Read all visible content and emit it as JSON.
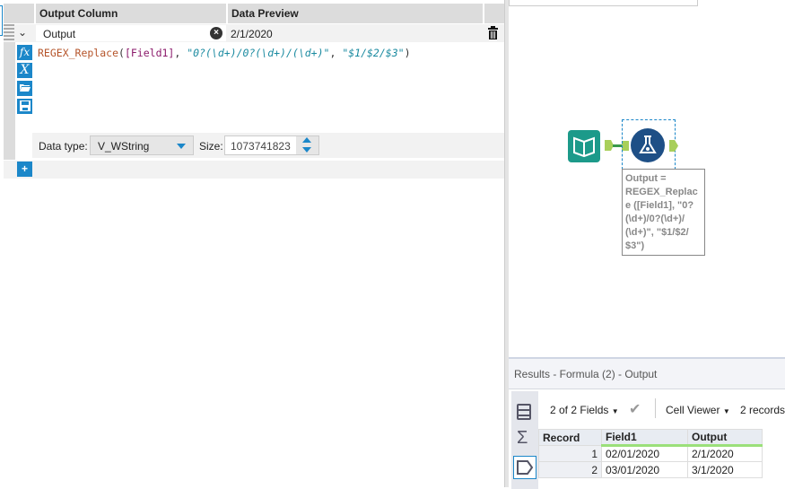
{
  "formula_panel": {
    "headers": {
      "output_column": "Output Column",
      "data_preview": "Data Preview"
    },
    "output_field": "Output",
    "preview": "2/1/2020",
    "expression": {
      "fn": "REGEX_Replace",
      "open": "(",
      "field": "[Field1]",
      "sep1": ", ",
      "pattern": "\"0?(\\d+)/0?(\\d+)/(\\d+)\"",
      "sep2": ", ",
      "replacement": "\"$1/$2/$3\"",
      "close": ")"
    },
    "data_type_label": "Data type:",
    "data_type": "V_WString",
    "size_label": "Size:",
    "size": "1073741823",
    "icons": {
      "fx": "fx",
      "var": "X"
    }
  },
  "canvas": {
    "annotation": "Output = REGEX_Replace ([Field1], \"0? (\\d+)/0?(\\d+)/ (\\d+)\", \"$1/$2/ $3\")"
  },
  "results": {
    "title": "Results - Formula (2) - Output",
    "fields": "2 of 2 Fields",
    "viewer": "Cell Viewer",
    "records": "2 records",
    "columns": [
      "Record",
      "Field1",
      "Output"
    ],
    "rows": [
      [
        "1",
        "02/01/2020",
        "2/1/2020"
      ],
      [
        "2",
        "03/01/2020",
        "3/1/2020"
      ]
    ]
  },
  "colors": {
    "accent": "#1b87c9",
    "connector": "#a8cf5a",
    "input_tool": "#1c9a8a",
    "formula_tool": "#1e4f86"
  }
}
